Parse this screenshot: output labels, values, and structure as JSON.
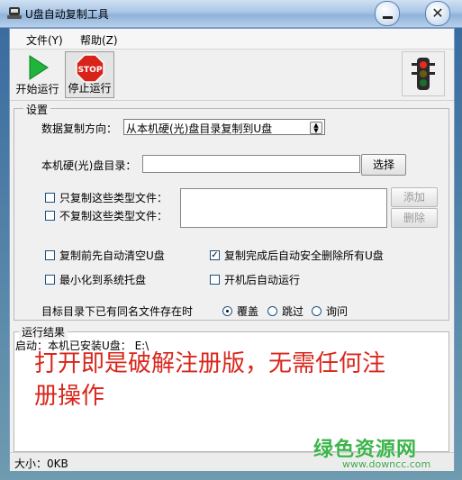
{
  "window": {
    "title": "U盘自动复制工具",
    "minimize": "minimize",
    "close": "close"
  },
  "menu": {
    "file": "文件(Y)",
    "help": "帮助(Z)"
  },
  "toolbar": {
    "start_label": "开始运行",
    "stop_label": "停止运行",
    "stop_sign_text": "STOP"
  },
  "settings": {
    "legend": "设置",
    "direction_label": "数据复制方向：",
    "direction_value": "从本机硬(光)盘目录复制到U盘",
    "dir_label": "本机硬(光)盘目录：",
    "dir_value": "",
    "browse_button": "选择",
    "only_types_label": "只复制这些类型文件：",
    "exclude_types_label": "不复制这些类型文件：",
    "add_button": "添加",
    "delete_button": "删除",
    "opt_clear_before": "复制前先自动清空U盘",
    "opt_safe_remove": "复制完成后自动安全删除所有U盘",
    "opt_minimize_tray": "最小化到系统托盘",
    "opt_autostart": "开机后自动运行",
    "safe_remove_checked": "✓",
    "conflict_label": "目标目录下已有同名文件存在时",
    "radio_overwrite": "覆盖",
    "radio_skip": "跳过",
    "radio_ask": "询问"
  },
  "results": {
    "legend": "运行结果",
    "log_line": "启动：本机已安装U盘：  E:\\",
    "overlay_line1": "打开即是破解注册版，无需任何注",
    "overlay_line2": "册操作"
  },
  "status": {
    "size": "大小：0KB"
  },
  "watermark": {
    "site_name": "绿色资源网",
    "url": "www.downcc.com"
  },
  "colors": {
    "overlay_red": "#d9261c",
    "watermark_green": "#3cb54a"
  }
}
